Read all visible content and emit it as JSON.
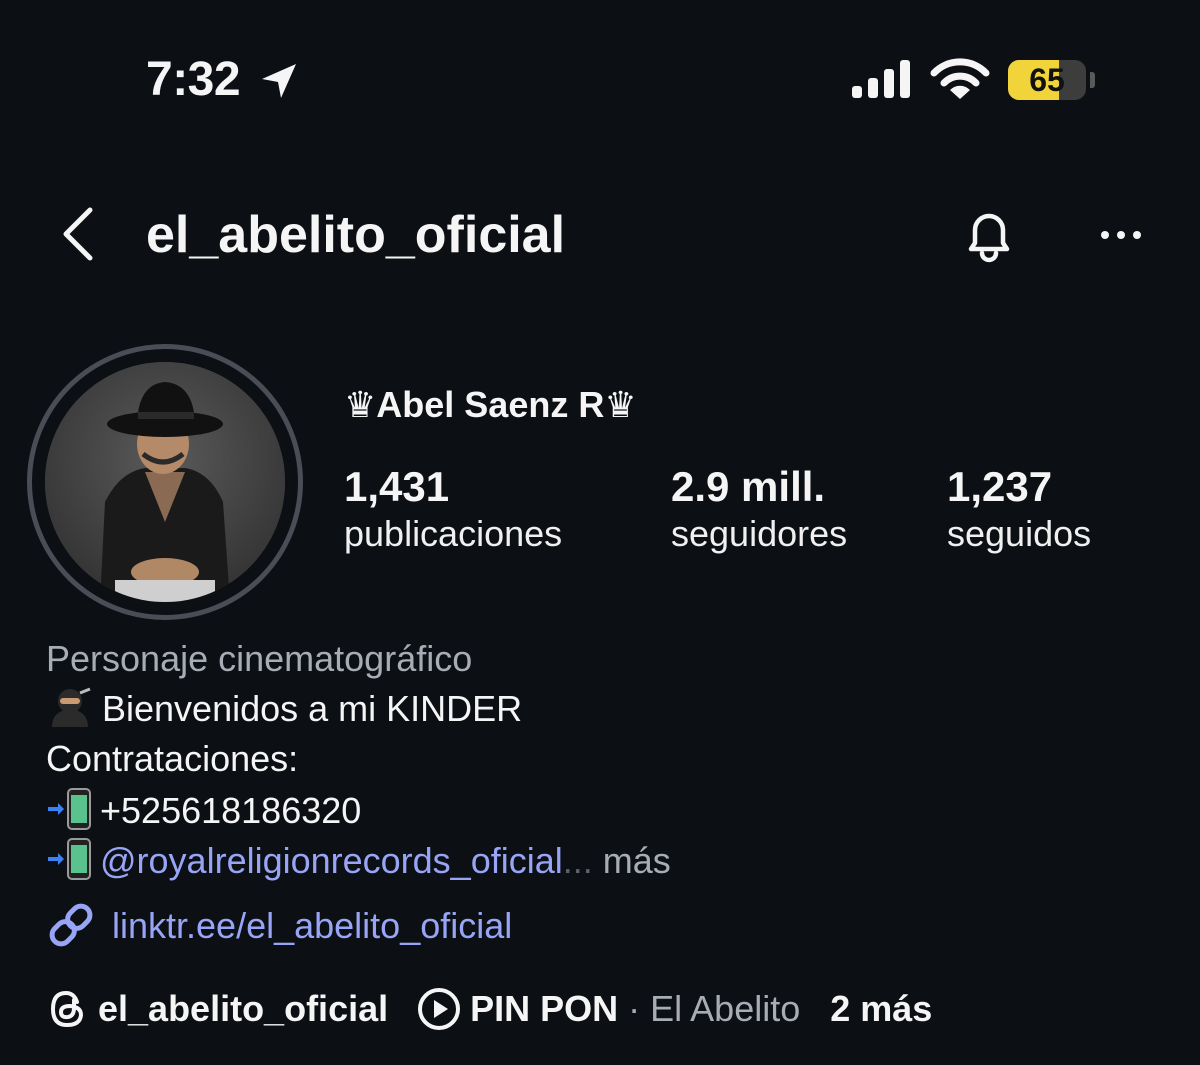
{
  "status_bar": {
    "time": "7:32",
    "battery": "65",
    "battery_level": 0.65
  },
  "header": {
    "username": "el_abelito_oficial"
  },
  "profile": {
    "display_name": "♛Abel Saenz R♛",
    "stats": [
      {
        "value": "1,431",
        "label": "publicaciones"
      },
      {
        "value": "2.9 mill.",
        "label": "seguidores"
      },
      {
        "value": "1,237",
        "label": "seguidos"
      }
    ]
  },
  "bio": {
    "category": "Personaje cinematográfico",
    "line1": "Bienvenidos a mi KINDER",
    "line2": "Contrataciones:",
    "phone": "+525618186320",
    "mention": "@royalreligionrecords_oficial",
    "ellipsis": "...",
    "more": "más",
    "link": "linktr.ee/el_abelito_oficial"
  },
  "chips": {
    "threads": "el_abelito_oficial",
    "song": "PIN PON",
    "separator": "·",
    "artist": "El Abelito",
    "more": "2 más"
  },
  "colors": {
    "background": "#0c0f14",
    "link": "#98a5f7",
    "secondary_text": "#a8acb4",
    "battery": "#f0d43a"
  },
  "icons": [
    "location-arrow-icon",
    "signal-icon",
    "wifi-icon",
    "battery-icon",
    "back-icon",
    "bell-icon",
    "more-icon",
    "link-icon",
    "threads-icon",
    "play-icon"
  ]
}
